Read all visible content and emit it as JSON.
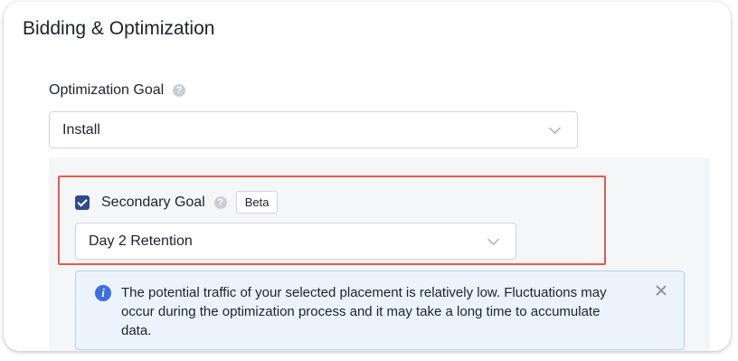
{
  "section": {
    "title": "Bidding & Optimization"
  },
  "optimization_goal": {
    "label": "Optimization Goal",
    "help_icon": "question-circle-icon",
    "selected": "Install"
  },
  "secondary_goal": {
    "checked": true,
    "label": "Secondary Goal",
    "help_icon": "question-circle-icon",
    "badge": "Beta",
    "selected": "Day 2 Retention"
  },
  "alert": {
    "icon": "info-icon",
    "icon_glyph": "i",
    "message": "The potential traffic of your selected placement is relatively low. Fluctuations may occur during the optimization process and it may take a long time to accumulate data.",
    "close_icon": "close-icon"
  },
  "colors": {
    "checkbox": "#2e4b8f",
    "highlight_border": "#e25c4f",
    "alert_bg": "#ebf3fd",
    "alert_border": "#b3d2f5",
    "info_icon": "#3e6fe0"
  }
}
